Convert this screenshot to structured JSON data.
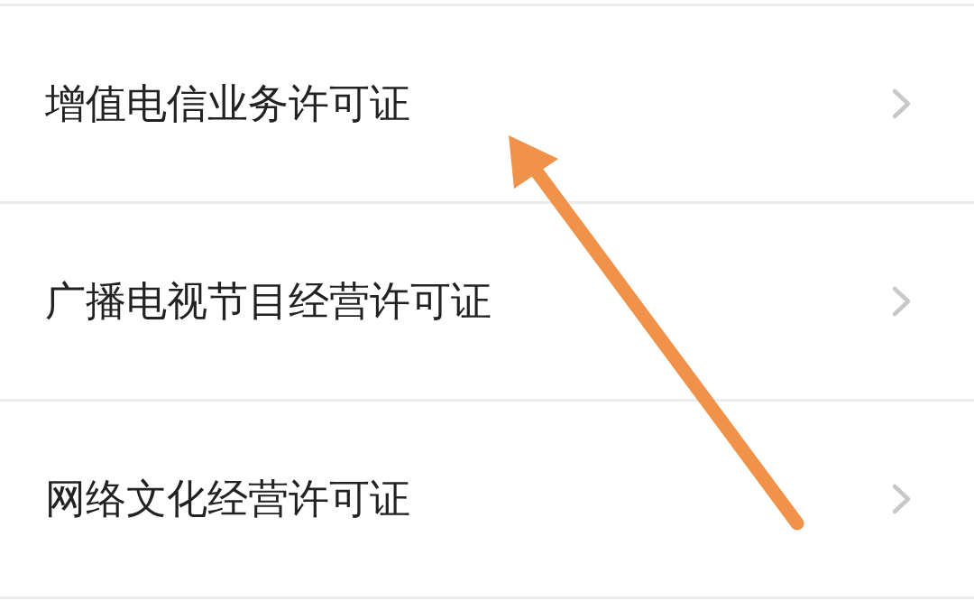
{
  "rows": [
    {
      "label": "增值电信业务许可证"
    },
    {
      "label": "广播电视节目经营许可证"
    },
    {
      "label": "网络文化经营许可证"
    }
  ],
  "annotation": {
    "kind": "arrow"
  }
}
